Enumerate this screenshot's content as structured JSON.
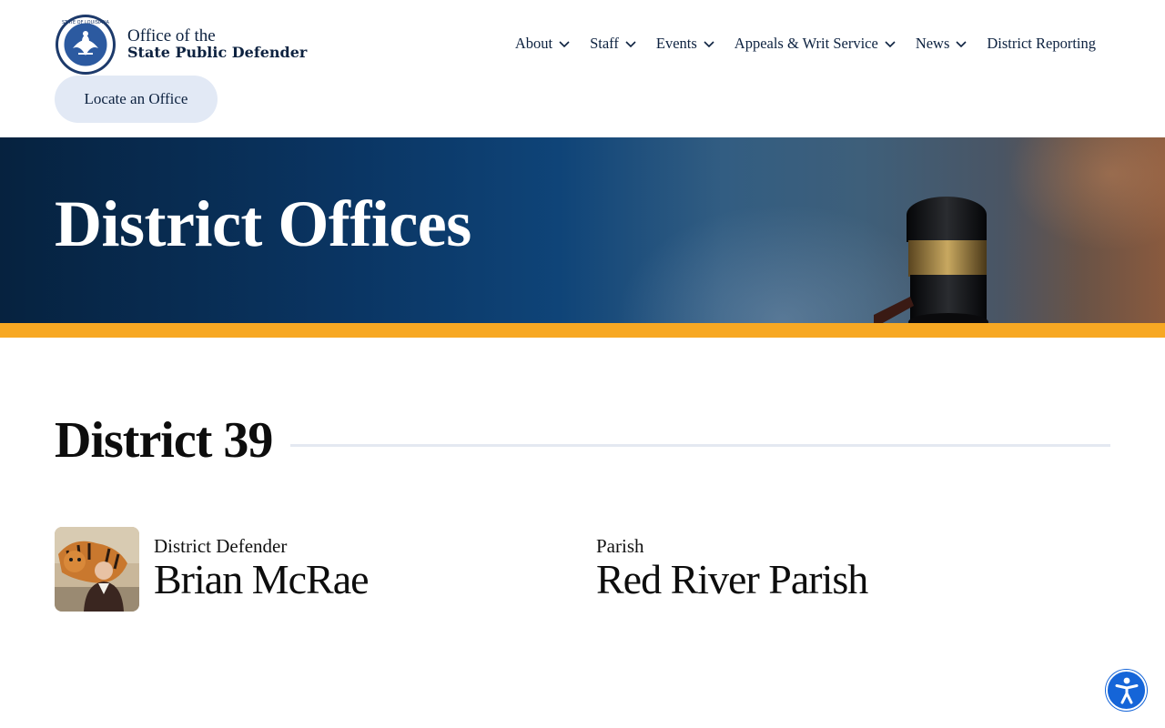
{
  "header": {
    "logo": {
      "line1": "Office of the",
      "line2": "State Public Defender",
      "seal_text": "STATE OF LOUISIANA"
    },
    "nav": [
      {
        "label": "About",
        "has_dropdown": true
      },
      {
        "label": "Staff",
        "has_dropdown": true
      },
      {
        "label": "Events",
        "has_dropdown": true
      },
      {
        "label": "Appeals & Writ Service",
        "has_dropdown": true
      },
      {
        "label": "News",
        "has_dropdown": true
      },
      {
        "label": "District Reporting",
        "has_dropdown": false
      }
    ],
    "locate_button": "Locate an Office"
  },
  "hero": {
    "title": "District Offices"
  },
  "district": {
    "heading": "District 39",
    "defender_label": "District Defender",
    "defender_name": "Brian McRae",
    "parish_label": "Parish",
    "parish_name": "Red River Parish"
  },
  "accessibility_button": {
    "icon": "accessibility-icon"
  },
  "colors": {
    "navy": "#0d2240",
    "accent_gold": "#f7a823",
    "button_bg": "#e2e9f5",
    "a11y_blue": "#1565d8"
  }
}
